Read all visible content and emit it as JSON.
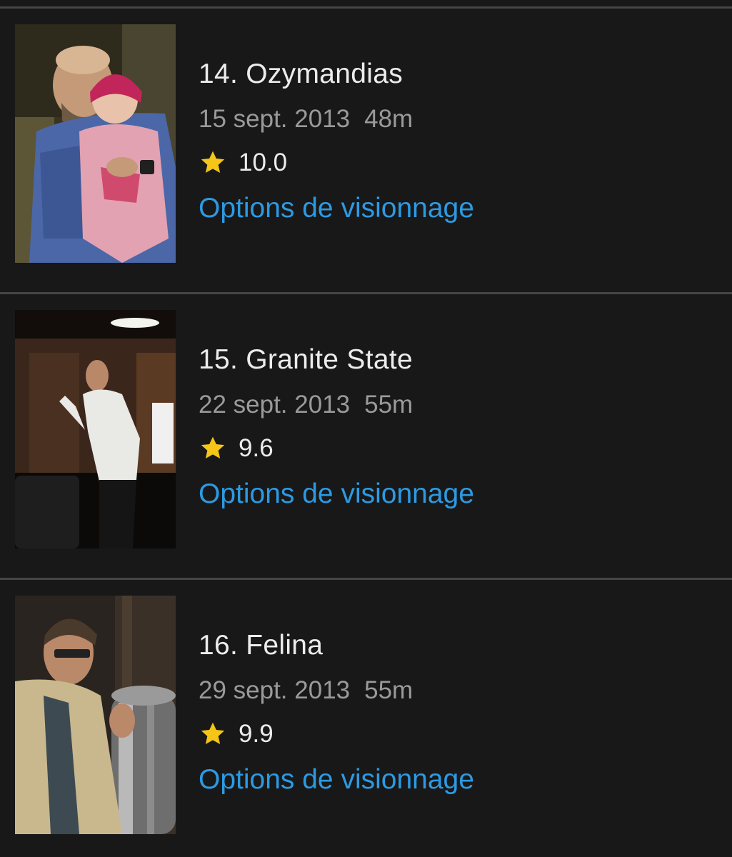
{
  "colors": {
    "background": "#181818",
    "divider": "#454545",
    "title_text": "#ececec",
    "meta_text": "#9a9a9a",
    "link": "#2c9ae3",
    "star": "#f5c518"
  },
  "episodes": [
    {
      "title": "14. Ozymandias",
      "date": "15 sept. 2013",
      "runtime": "48m",
      "rating": "10.0",
      "rating_icon": "star-icon",
      "watch_options_label": "Options de visionnage"
    },
    {
      "title": "15. Granite State",
      "date": "22 sept. 2013",
      "runtime": "55m",
      "rating": "9.6",
      "rating_icon": "star-icon",
      "watch_options_label": "Options de visionnage"
    },
    {
      "title": "16. Felina",
      "date": "29 sept. 2013",
      "runtime": "55m",
      "rating": "9.9",
      "rating_icon": "star-icon",
      "watch_options_label": "Options de visionnage"
    }
  ]
}
